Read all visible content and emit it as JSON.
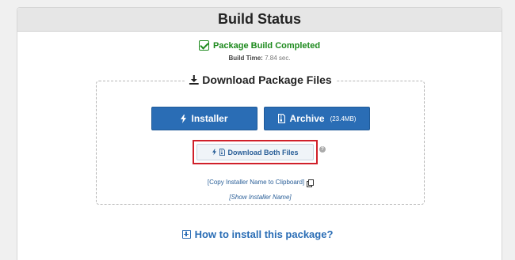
{
  "panel": {
    "title": "Build Status"
  },
  "status": {
    "text": "Package Build Completed",
    "color": "#1d8a1d",
    "icon": "check-square-icon",
    "build_time_label": "Build Time:",
    "build_time_value": "7.84 sec."
  },
  "download": {
    "title": "Download Package Files",
    "title_icon": "download-icon",
    "installer_label": "Installer",
    "installer_icon": "bolt-icon",
    "archive_label": "Archive",
    "archive_size": "(23.4MB)",
    "archive_icon": "file-archive-icon",
    "both_label": "Download Both Files",
    "both_icons": [
      "bolt-icon",
      "file-archive-icon"
    ],
    "help_icon": "question-circle-icon",
    "copy_link": "[Copy Installer Name to Clipboard]",
    "copy_icon": "copy-icon",
    "show_name": "[Show Installer Name]",
    "button_color": "#2a6db5",
    "highlight_color": "#d0202a"
  },
  "footer": {
    "how_to": "How to install this package?",
    "how_to_icon": "plus-square-icon"
  }
}
